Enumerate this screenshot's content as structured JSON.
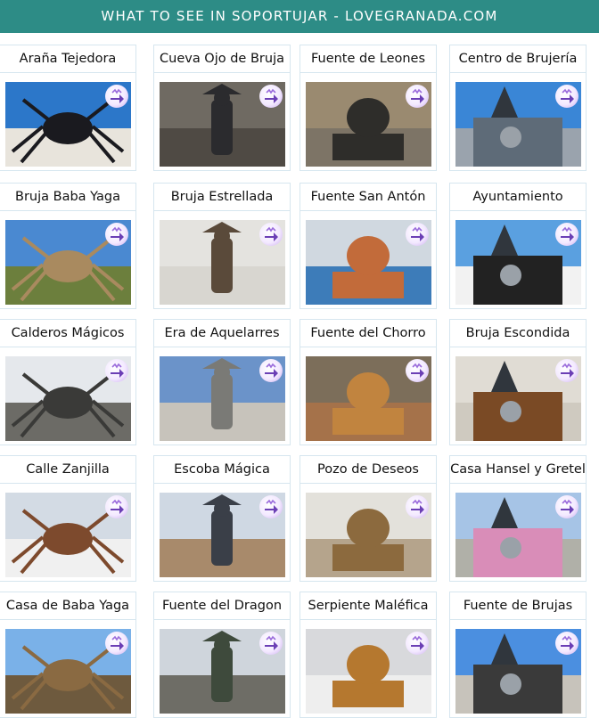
{
  "banner": {
    "title": "WHAT TO SEE IN SOPORTUJAR - LOVEGRANADA.COM"
  },
  "items": [
    {
      "label": "Araña Tejedora",
      "colors": {
        "sky": "#2c77c9",
        "ground": "#e8e4dc",
        "subject": "#1a1a1f"
      },
      "icon": "spider-sculpture-icon"
    },
    {
      "label": "Cueva Ojo de Bruja",
      "colors": {
        "sky": "#6f6a62",
        "ground": "#4f4a44",
        "subject": "#2b2b2e"
      },
      "icon": "witch-figure-icon"
    },
    {
      "label": "Fuente de Leones",
      "colors": {
        "sky": "#9a8a70",
        "ground": "#7d7466",
        "subject": "#2e2d2a"
      },
      "icon": "lion-fountain-icon"
    },
    {
      "label": "Centro de Brujería",
      "colors": {
        "sky": "#3a86d6",
        "ground": "#9aa3ad",
        "subject": "#5e6b78"
      },
      "icon": "tower-building-icon"
    },
    {
      "label": "Bruja Baba Yaga",
      "colors": {
        "sky": "#4a89d1",
        "ground": "#6c7f3d",
        "subject": "#a98a5f"
      },
      "icon": "witch-statue-icon"
    },
    {
      "label": "Bruja Estrellada",
      "colors": {
        "sky": "#e4e3df",
        "ground": "#d8d6d0",
        "subject": "#5a4a3a"
      },
      "icon": "crashed-witch-icon"
    },
    {
      "label": "Fuente San Antón",
      "colors": {
        "sky": "#d0d8e0",
        "ground": "#3d7cb9",
        "subject": "#c26b3a"
      },
      "icon": "tiled-fountain-icon"
    },
    {
      "label": "Ayuntamiento",
      "colors": {
        "sky": "#5aa0e0",
        "ground": "#f2f2f2",
        "subject": "#222222"
      },
      "icon": "clock-icon"
    },
    {
      "label": "Calderos Mágicos",
      "colors": {
        "sky": "#e5e8ec",
        "ground": "#6c6b66",
        "subject": "#3a3a38"
      },
      "icon": "cauldron-icon"
    },
    {
      "label": "Era de Aquelarres",
      "colors": {
        "sky": "#6b93c9",
        "ground": "#c7c3bb",
        "subject": "#7a7a76"
      },
      "icon": "stone-book-icon"
    },
    {
      "label": "Fuente del Chorro",
      "colors": {
        "sky": "#7c6e5a",
        "ground": "#a5724a",
        "subject": "#c1843f"
      },
      "icon": "fountain-wall-icon"
    },
    {
      "label": "Bruja Escondida",
      "colors": {
        "sky": "#e0dcd4",
        "ground": "#cfcac0",
        "subject": "#7a4a25"
      },
      "icon": "wooden-door-icon"
    },
    {
      "label": "Calle Zanjilla",
      "colors": {
        "sky": "#d3dbe4",
        "ground": "#f0f0f0",
        "subject": "#7d4a2d"
      },
      "icon": "street-sign-icon"
    },
    {
      "label": "Escoba Mágica",
      "colors": {
        "sky": "#cfd8e3",
        "ground": "#a88a6b",
        "subject": "#3a3f48"
      },
      "icon": "broom-icon"
    },
    {
      "label": "Pozo de Deseos",
      "colors": {
        "sky": "#e3e1db",
        "ground": "#b5a48c",
        "subject": "#8c6a3e"
      },
      "icon": "well-icon"
    },
    {
      "label": "Casa Hansel y Gretel",
      "colors": {
        "sky": "#a6c4e6",
        "ground": "#b0b0a8",
        "subject": "#d98db8"
      },
      "icon": "candy-house-icon"
    },
    {
      "label": "Casa de Baba Yaga",
      "colors": {
        "sky": "#7ab1e8",
        "ground": "#6e5a3e",
        "subject": "#8a6a42"
      },
      "icon": "wooden-hut-icon"
    },
    {
      "label": "Fuente del Dragon",
      "colors": {
        "sky": "#cfd5dc",
        "ground": "#6e6d66",
        "subject": "#3e4a3c"
      },
      "icon": "dragon-statue-icon"
    },
    {
      "label": "Serpiente Maléfica",
      "colors": {
        "sky": "#d8d9dc",
        "ground": "#eeeeee",
        "subject": "#b5782f"
      },
      "icon": "serpent-icon"
    },
    {
      "label": "Fuente de Brujas",
      "colors": {
        "sky": "#4b8fe0",
        "ground": "#c7c3bb",
        "subject": "#3a3a3a"
      },
      "icon": "witches-fountain-icon"
    }
  ]
}
